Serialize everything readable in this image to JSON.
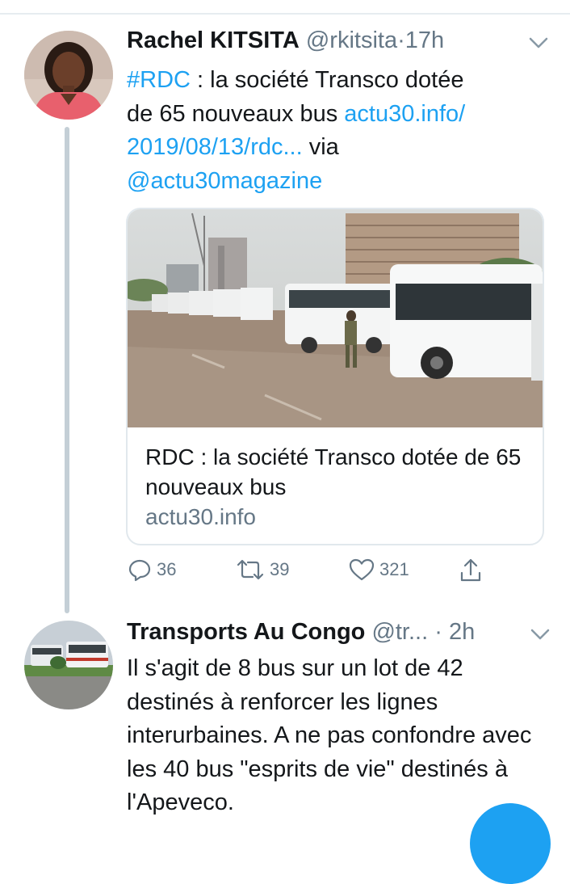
{
  "tweet1": {
    "author_name": "Rachel KITSITA",
    "handle": "@rkitsita",
    "separator": "·",
    "time": "17h",
    "text": {
      "hashtag": "#RDC",
      "line1_rest": " : la société Transco dotée",
      "line2_plain": "de 65 nouveaux bus ",
      "link_part1": "actu30.info/",
      "link_part2": "2019/08/13/rdc...",
      "via": " via",
      "mention": "@actu30magazine"
    },
    "card": {
      "title": "RDC : la société Transco dotée de 65 nouveaux bus",
      "domain": "actu30.info"
    },
    "actions": {
      "replies": "36",
      "retweets": "39",
      "likes": "321"
    }
  },
  "tweet2": {
    "author_name": "Transports Au Congo",
    "handle": "@tr...",
    "separator": "·",
    "time": "2h",
    "text": "Il s'agit de 8 bus sur un lot de 42 destinés à renforcer les lignes interurbaines. A ne pas confondre avec les 40 bus \"esprits de vie\" destinés à l'Apeveco."
  },
  "colors": {
    "accent": "#1da1f2",
    "text_primary": "#14171a",
    "text_secondary": "#657786",
    "border": "#e1e8ed"
  },
  "icons": {
    "reply": "reply-icon",
    "retweet": "retweet-icon",
    "like": "heart-icon",
    "share": "share-icon",
    "menu": "chevron-down-icon"
  }
}
